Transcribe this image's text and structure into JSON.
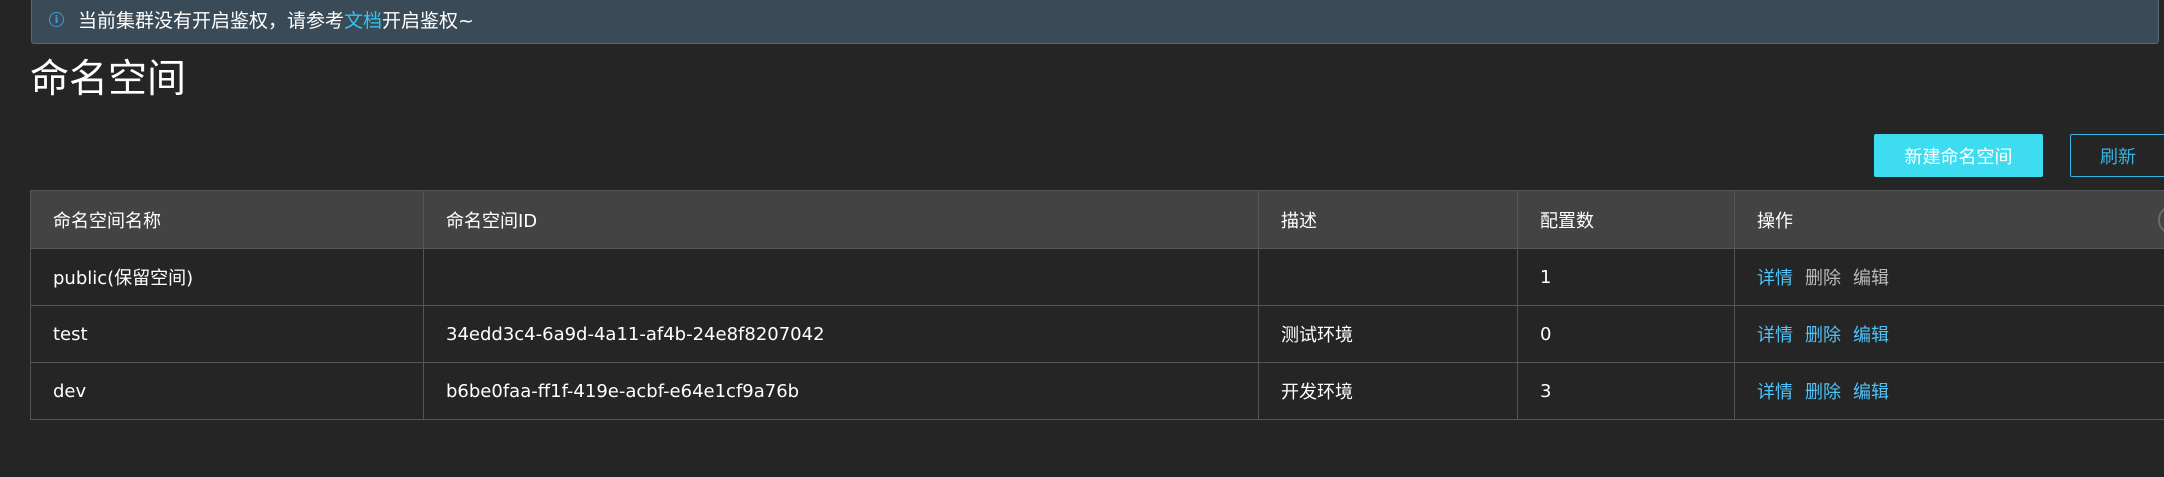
{
  "alert": {
    "icon": "info-icon",
    "text_before": "当前集群没有开启鉴权，请参考",
    "link_text": "文档",
    "text_after": "开启鉴权~"
  },
  "title": "命名空间",
  "toolbar": {
    "create_label": "新建命名空间",
    "refresh_label": "刷新"
  },
  "table": {
    "columns": [
      "命名空间名称",
      "命名空间ID",
      "描述",
      "配置数",
      "操作"
    ],
    "rows": [
      {
        "name": "public(保留空间)",
        "id": "",
        "desc": "",
        "count": "1",
        "ops": [
          "详情",
          "删除",
          "编辑"
        ]
      },
      {
        "name": "test",
        "id": "34edd3c4-6a9d-4a11-af4b-24e8f8207042",
        "desc": "测试环境",
        "count": "0",
        "ops": [
          "详情",
          "删除",
          "编辑"
        ]
      },
      {
        "name": "dev",
        "id": "b6be0faa-ff1f-419e-acbf-e64e1cf9a76b",
        "desc": "开发环境",
        "count": "3",
        "ops": [
          "详情",
          "删除",
          "编辑"
        ]
      }
    ]
  },
  "colors": {
    "accent": "#3ddcf0",
    "link": "#33c3f0",
    "background": "#252526"
  }
}
